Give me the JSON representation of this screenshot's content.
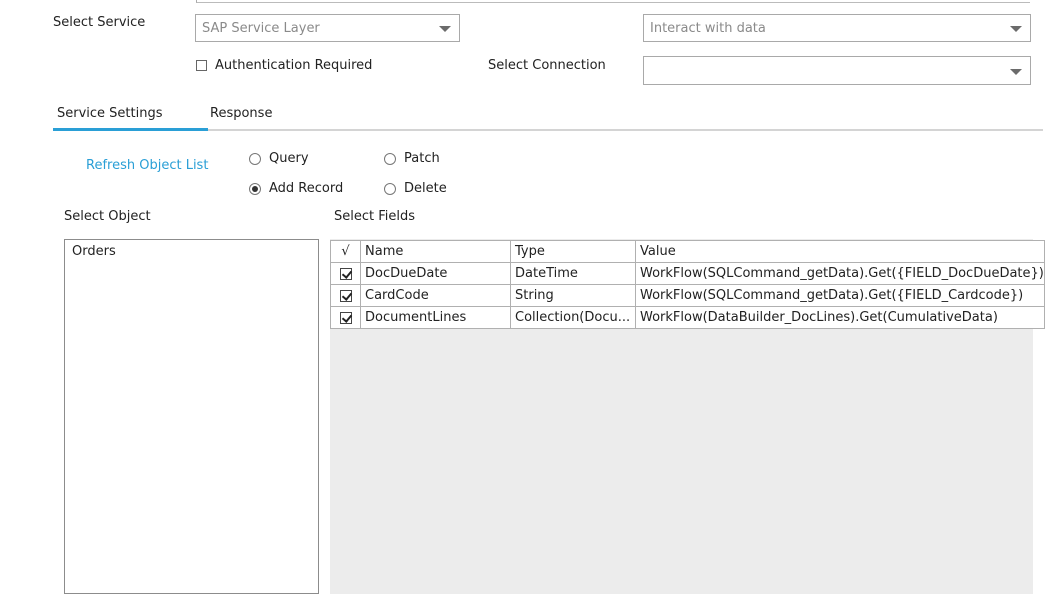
{
  "service": {
    "label": "Select Service",
    "service_type_value": "SAP Service Layer",
    "mode_value": "Interact with data",
    "auth_label": "Authentication Required",
    "auth_checked": false,
    "connection_label": "Select Connection",
    "connection_value": ""
  },
  "tabs": [
    {
      "label": "Service Settings",
      "active": true
    },
    {
      "label": "Response",
      "active": false
    }
  ],
  "settings": {
    "refresh_link": "Refresh Object List",
    "operations": [
      {
        "label": "Query",
        "selected": false
      },
      {
        "label": "Patch",
        "selected": false
      },
      {
        "label": "Add Record",
        "selected": true
      },
      {
        "label": "Delete",
        "selected": false
      }
    ],
    "select_object_label": "Select Object",
    "select_fields_label": "Select Fields",
    "objects": [
      "Orders"
    ]
  },
  "fields_table": {
    "headers": {
      "check": "√",
      "name": "Name",
      "type": "Type",
      "value": "Value"
    },
    "rows": [
      {
        "checked": true,
        "name": "DocDueDate",
        "type": "DateTime",
        "value": "WorkFlow(SQLCommand_getData).Get({FIELD_DocDueDate})"
      },
      {
        "checked": true,
        "name": "CardCode",
        "type": "String",
        "value": "WorkFlow(SQLCommand_getData).Get({FIELD_Cardcode})"
      },
      {
        "checked": true,
        "name": "DocumentLines",
        "type": "Collection(Docu...",
        "value": "WorkFlow(DataBuilder_DocLines).Get(CumulativeData)"
      }
    ]
  },
  "colors": {
    "accent": "#2a9fd6",
    "tab_underline": "#d4d4d4"
  }
}
